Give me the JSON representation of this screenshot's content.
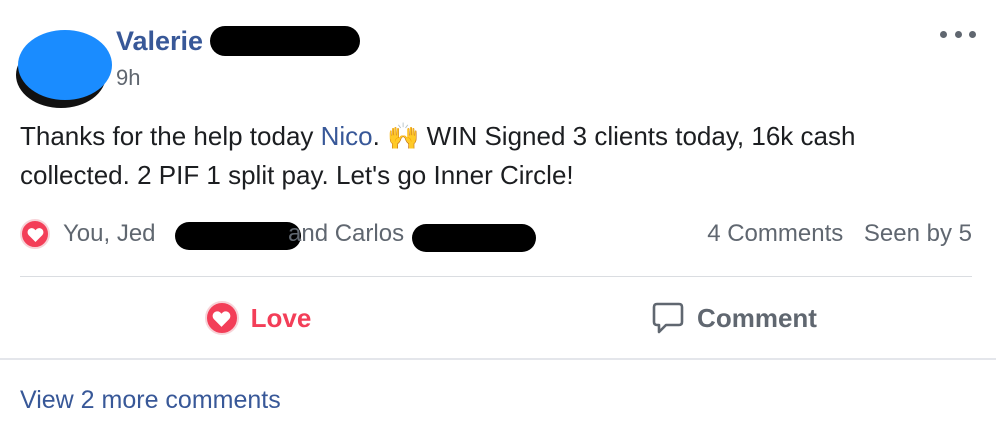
{
  "post": {
    "author_name": "Valerie",
    "timestamp": "9h",
    "more_icon": "more-horizontal-icon",
    "text_before_mention": "Thanks for the help today ",
    "mention": "Nico",
    "text_after_mention": ". 🙌 WIN Signed 3 clients today, 16k cash collected. 2 PIF 1 split pay. Let's go Inner Circle!"
  },
  "reactions": {
    "icon": "love-reaction-icon",
    "you_jed": "You, Jed",
    "and_carlos": "and Carlos",
    "comments_count": "4 Comments",
    "seen_by": "Seen by 5"
  },
  "actions": {
    "love_label": "Love",
    "comment_label": "Comment"
  },
  "comments": {
    "view_more": "View 2 more comments"
  },
  "colors": {
    "link": "#385898",
    "love": "#f33e58",
    "secondary_text": "#606770",
    "avatar": "#1a8cff"
  }
}
